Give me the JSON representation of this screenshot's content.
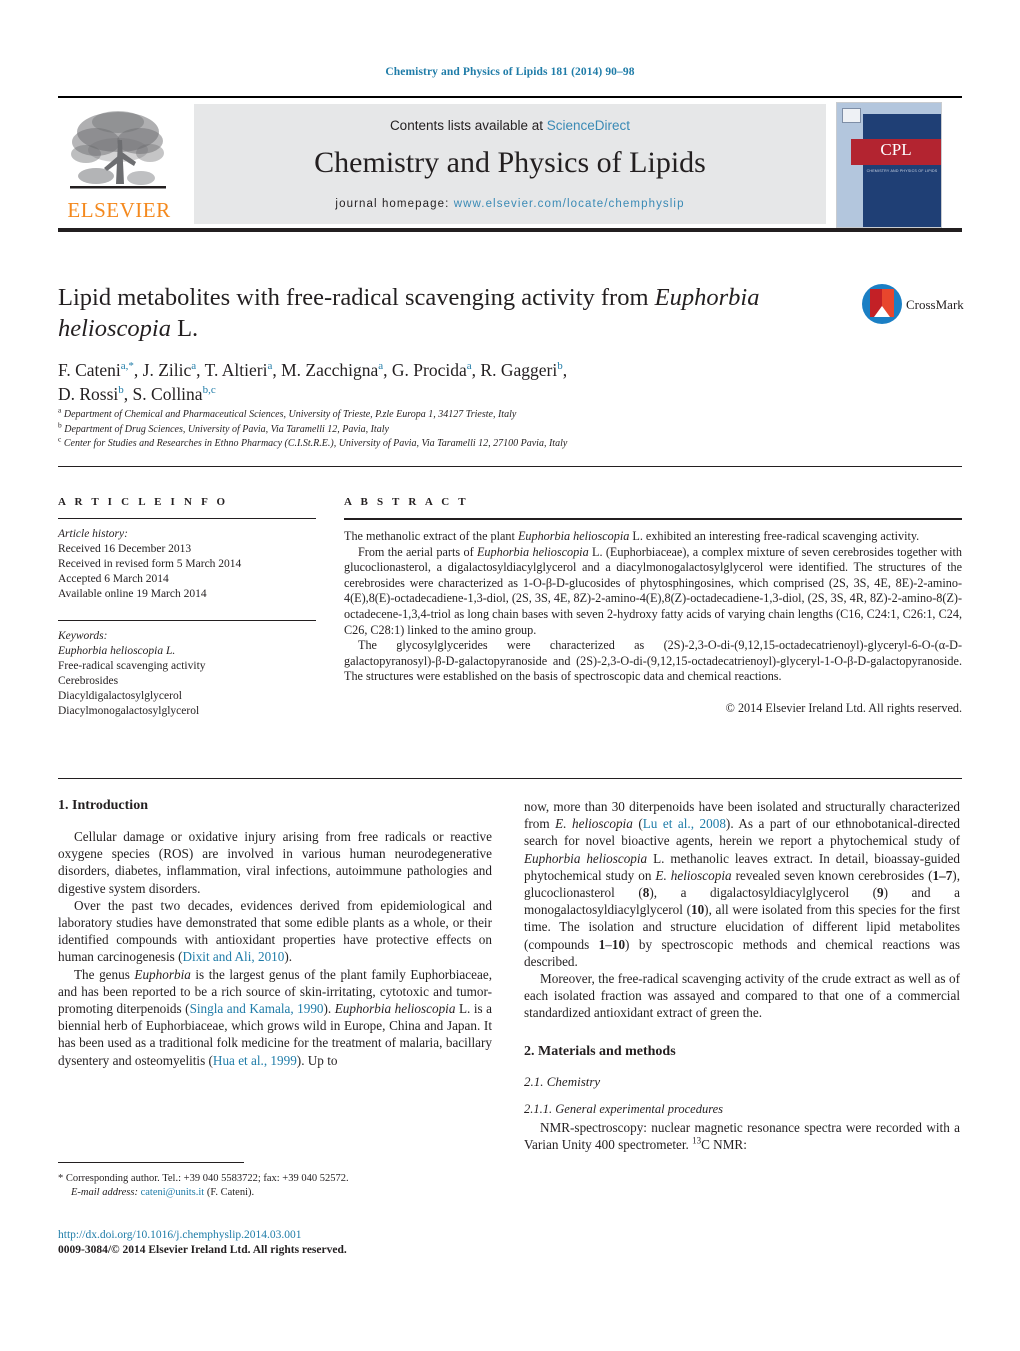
{
  "running_head": "Chemistry and Physics of Lipids 181 (2014) 90–98",
  "masthead": {
    "contents_prefix": "Contents lists available at ",
    "sciencedirect": "ScienceDirect",
    "journal_title": "Chemistry and Physics of Lipids",
    "homepage_prefix": "journal homepage: ",
    "homepage_url": "www.elsevier.com/locate/chemphyslip",
    "publisher_logo_text": "ELSEVIER",
    "cover": {
      "code": "CPL",
      "subtitle": "CHEMISTRY AND PHYSICS OF LIPIDS"
    }
  },
  "article": {
    "title_part1": "Lipid metabolites with free-radical scavenging activity from ",
    "title_italic": "Euphorbia helioscopia",
    "title_part2": " L.",
    "crossmark_label": "CrossMark",
    "authors": "F. Cateni a,*, J. Zilic a, T. Altieri a, M. Zacchigna a, G. Procida a, R. Gaggeri b, D. Rossi b, S. Collina b,c",
    "affiliations": [
      "Department of Chemical and Pharmaceutical Sciences, University of Trieste, P.zle Europa 1, 34127 Trieste, Italy",
      "Department of Drug Sciences, University of Pavia, Via Taramelli 12, Pavia, Italy",
      "Center for Studies and Researches in Ethno Pharmacy (C.I.St.R.E.), University of Pavia, Via Taramelli 12, 27100 Pavia, Italy"
    ]
  },
  "article_info": {
    "heading": "A R T I C L E   I N F O",
    "history_label": "Article history:",
    "history": [
      "Received 16 December 2013",
      "Received in revised form 5 March 2014",
      "Accepted 6 March 2014",
      "Available online 19 March 2014"
    ],
    "keywords_label": "Keywords:",
    "keywords": [
      "Euphorbia helioscopia L.",
      "Free-radical scavenging activity",
      "Cerebrosides",
      "Diacyldigalactosylglycerol",
      "Diacylmonogalactosylglycerol"
    ]
  },
  "abstract": {
    "heading": "A B S T R A C T",
    "paragraph1_a": "The methanolic extract of the plant ",
    "paragraph1_italic": "Euphorbia helioscopia",
    "paragraph1_b": " L. exhibited an interesting free-radical scavenging activity.",
    "paragraph2_a": "From the aerial parts of ",
    "paragraph2_italic": "Euphorbia helioscopia",
    "paragraph2_b": " L. (Euphorbiaceae), a complex mixture of seven cerebrosides together with glucoclionasterol, a digalactosyldiacylglycerol and a diacylmonogalactosylglycerol were identified. The structures of the cerebrosides were characterized as 1-O-β-D-glucosides of phytosphingosines, which comprised (2S, 3S, 4E, 8E)-2-amino-4(E),8(E)-octadecadiene-1,3-diol, (2S, 3S, 4E, 8Z)-2-amino-4(E),8(Z)-octadecadiene-1,3-diol, (2S, 3S, 4R, 8Z)-2-amino-8(Z)-octadecene-1,3,4-triol as long chain bases with seven 2-hydroxy fatty acids of varying chain lengths (C16, C24:1, C26:1, C24, C26, C28:1) linked to the amino group.",
    "paragraph3": "The glycosylglycerides were characterized as (2S)-2,3-O-di-(9,12,15-octadecatrienoyl)-glyceryl-6-O-(α-D-galactopyranosyl)-β-D-galactopyranoside and (2S)-2,3-O-di-(9,12,15-octadecatrienoyl)-glyceryl-1-O-β-D-galactopyranoside. The structures were established on the basis of spectroscopic data and chemical reactions.",
    "copyright": "© 2014 Elsevier Ireland Ltd. All rights reserved."
  },
  "body": {
    "intro_heading": "1. Introduction",
    "left_paragraphs": [
      "Cellular damage or oxidative injury arising from free radicals or reactive oxygene species (ROS) are involved in various human neurodegenerative disorders, diabetes, inflammation, viral infections, autoimmune pathologies and digestive system disorders.",
      "Over the past two decades, evidences derived from epidemiological and laboratory studies have demonstrated that some edible plants as a whole, or their identified compounds with antioxidant properties have protective effects on human carcinogenesis (Dixit and Ali, 2010).",
      "The genus Euphorbia is the largest genus of the plant family Euphorbiaceae, and has been reported to be a rich source of skin-irritating, cytotoxic and tumor-promoting diterpenoids (Singla and Kamala, 1990). Euphorbia helioscopia L. is a biennial herb of Euphorbiaceae, which grows wild in Europe, China and Japan. It has been used as a traditional folk medicine for the treatment of malaria, bacillary dysentery and osteomyelitis (Hua et al., 1999). Up to"
    ],
    "right_paragraph_cont": "now, more than 30 diterpenoids have been isolated and structurally characterized from E. helioscopia (Lu et al., 2008). As a part of our ethnobotanical-directed search for novel bioactive agents, herein we report a phytochemical study of Euphorbia helioscopia L. methanolic leaves extract. In detail, bioassay-guided phytochemical study on E. helioscopia revealed seven known cerebrosides (1–7), glucoclionasterol (8), a digalactosyldiacylglycerol (9) and a monogalactosyldiacylglycerol (10), all were isolated from this species for the first time. The isolation and structure elucidation of different lipid metabolites (compounds 1–10) by spectroscopic methods and chemical reactions was described.",
    "right_paragraph_2": "Moreover, the free-radical scavenging activity of the crude extract as well as of each isolated fraction was assayed and compared to that one of a commercial standardized antioxidant extract of green the.",
    "materials_heading": "2. Materials and methods",
    "chemistry_heading": "2.1. Chemistry",
    "general_heading": "2.1.1. General experimental procedures",
    "general_text": "NMR-spectroscopy: nuclear magnetic resonance spectra were recorded with a Varian Unity 400 spectrometer. 13C NMR:",
    "refs": {
      "dixit": "Dixit and Ali, 2010",
      "singla": "Singla and Kamala, 1990",
      "hua": "Hua et al., 1999",
      "lu": "Lu et al., 2008"
    }
  },
  "footer": {
    "corresponding": "* Corresponding author. Tel.: +39 040 5583722; fax: +39 040 52572.",
    "email_label": "E-mail address:",
    "email": "cateni@units.it",
    "email_suffix": " (F. Cateni).",
    "doi": "http://dx.doi.org/10.1016/j.chemphyslip.2014.03.001",
    "issn": "0009-3084/© 2014 Elsevier Ireland Ltd. All rights reserved."
  },
  "colors": {
    "link_blue": "#1f7ca8",
    "elsevier_orange": "#f4891e",
    "cover_navy": "#1f3f75",
    "cover_red": "#b32430",
    "crossmark_blue": "#1b7fc4"
  }
}
